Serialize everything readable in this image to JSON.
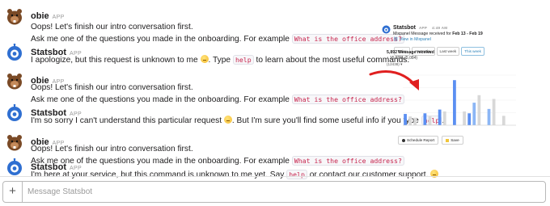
{
  "messages": [
    {
      "sender": "obie",
      "app_badge": "APP",
      "avatar": "beaver-icon",
      "lines": [
        {
          "parts": [
            {
              "t": "text",
              "v": "Oops! Let's finish our intro conversation first."
            }
          ]
        },
        {
          "parts": [
            {
              "t": "text",
              "v": "Ask me one of the questions you made in the onboarding. For example "
            },
            {
              "t": "code",
              "v": "What is the office address?"
            }
          ]
        }
      ]
    },
    {
      "sender": "Statsbot",
      "app_badge": "APP",
      "avatar": "robot-icon",
      "lines": [
        {
          "parts": [
            {
              "t": "text",
              "v": "I apologize, but this request is unknown to me "
            },
            {
              "t": "emoji",
              "v": "thinking-face"
            },
            {
              "t": "text",
              "v": ". Type "
            },
            {
              "t": "code",
              "v": "help"
            },
            {
              "t": "text",
              "v": " to learn about the most useful commands."
            }
          ]
        }
      ]
    },
    {
      "sender": "obie",
      "app_badge": "APP",
      "avatar": "beaver-icon",
      "lines": [
        {
          "parts": [
            {
              "t": "text",
              "v": "Oops! Let's finish our intro conversation first."
            }
          ]
        },
        {
          "parts": [
            {
              "t": "text",
              "v": "Ask me one of the questions you made in the onboarding. For example "
            },
            {
              "t": "code",
              "v": "What is the office address?"
            }
          ]
        }
      ]
    },
    {
      "sender": "Statsbot",
      "app_badge": "APP",
      "avatar": "robot-icon",
      "lines": [
        {
          "parts": [
            {
              "t": "text",
              "v": "I'm so sorry I can't understand this particular request "
            },
            {
              "t": "emoji",
              "v": "thinking-face"
            },
            {
              "t": "text",
              "v": ". But I'm sure you'll find some useful info if you type "
            },
            {
              "t": "code",
              "v": "help"
            },
            {
              "t": "text",
              "v": "."
            }
          ]
        }
      ]
    },
    {
      "sender": "obie",
      "app_badge": "APP",
      "avatar": "beaver-icon",
      "lines": [
        {
          "parts": [
            {
              "t": "text",
              "v": "Oops! Let's finish our intro conversation first."
            }
          ]
        },
        {
          "parts": [
            {
              "t": "text",
              "v": "Ask me one of the questions you made in the onboarding. For example "
            },
            {
              "t": "code",
              "v": "What is the office address?"
            }
          ]
        }
      ]
    },
    {
      "sender": "Statsbot",
      "app_badge": "APP",
      "avatar": "robot-icon",
      "lines": [
        {
          "parts": [
            {
              "t": "text",
              "v": "I'm here at your service, but this command is unknown to me yet. Say "
            },
            {
              "t": "code",
              "v": "help"
            },
            {
              "t": "text",
              "v": " or contact our customer support. "
            },
            {
              "t": "emoji",
              "v": "thinking-face"
            }
          ]
        }
      ]
    }
  ],
  "card": {
    "sender": "Statsbot",
    "app_badge": "APP",
    "time": "4:49 AM",
    "subtitle_prefix": "Mixpanel Message received for ",
    "subtitle_range": "Feb 13 - Feb 19",
    "link": "View in Mixpanel",
    "ranges": [
      "Today",
      "Yesterday",
      "Last week",
      "This week"
    ],
    "active_range": "This week",
    "metric": "5,892 Message received",
    "delta": "15.89% (5,084)",
    "dropdown": "(12438)",
    "buttons": [
      "Schedule Report",
      "Save"
    ],
    "accent": "#2a80b9",
    "annotation_color": "#e01f1f"
  },
  "chart_data": {
    "type": "bar",
    "categories": [
      "1",
      "2",
      "3",
      "4",
      "5",
      "6",
      "7",
      "8",
      "9",
      "10",
      "11",
      "12",
      "13",
      "14",
      "15",
      "16",
      "17",
      "18",
      "19",
      "20",
      "21",
      "22",
      "23"
    ],
    "series": [
      {
        "color": "#5b8ff2",
        "values": [
          18,
          0,
          0,
          0,
          19,
          0,
          0,
          25,
          0,
          0,
          72,
          0,
          0,
          19,
          0,
          0,
          0,
          0,
          0,
          0,
          0,
          0,
          0
        ]
      },
      {
        "color": "#d8d8d8",
        "values": [
          0,
          14,
          12,
          0,
          0,
          14,
          0,
          0,
          22,
          0,
          0,
          0,
          22,
          0,
          0,
          48,
          0,
          0,
          42,
          0,
          15,
          0,
          0
        ]
      },
      {
        "color": "#8cb6f5",
        "values": [
          0,
          0,
          0,
          0,
          0,
          0,
          0,
          0,
          0,
          0,
          0,
          0,
          0,
          0,
          36,
          0,
          0,
          26,
          0,
          0,
          0,
          0,
          0
        ]
      }
    ],
    "ylim": [
      0,
      80
    ],
    "grid": true
  },
  "composer": {
    "placeholder": "Message Statsbot"
  }
}
